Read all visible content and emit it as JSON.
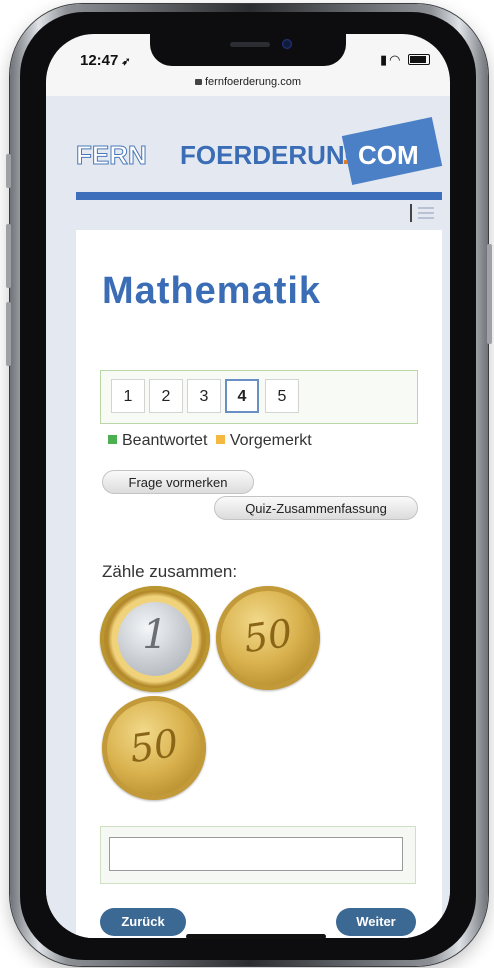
{
  "status_bar": {
    "time": "12:47",
    "icons": "signal wifi battery"
  },
  "browser": {
    "url": "fernfoerderung.com"
  },
  "logo": {
    "part1": "FERN",
    "part2": "FOERDERUNG",
    "dot": ".",
    "part3": "COM"
  },
  "header": {
    "menu_icon": "hamburger-menu-icon"
  },
  "page": {
    "title": "Mathematik"
  },
  "quiz_nav": {
    "questions": [
      "1",
      "2",
      "3",
      "4",
      "5"
    ],
    "active": "4"
  },
  "legend": {
    "answered_label": "Beantwortet",
    "answered_color": "#4caf50",
    "marked_label": "Vorgemerkt",
    "marked_color": "#f5b841"
  },
  "buttons": {
    "mark_question": "Frage vormerken",
    "quiz_summary": "Quiz-Zusammenfassung",
    "back": "Zurück",
    "next": "Weiter"
  },
  "question": {
    "prompt": "Zähle zusammen:",
    "coins": [
      {
        "type": "euro-coin",
        "label": "1"
      },
      {
        "type": "cent-coin",
        "label": "50"
      },
      {
        "type": "cent-coin",
        "label": "50"
      }
    ]
  },
  "answer": {
    "value": "",
    "placeholder": ""
  }
}
